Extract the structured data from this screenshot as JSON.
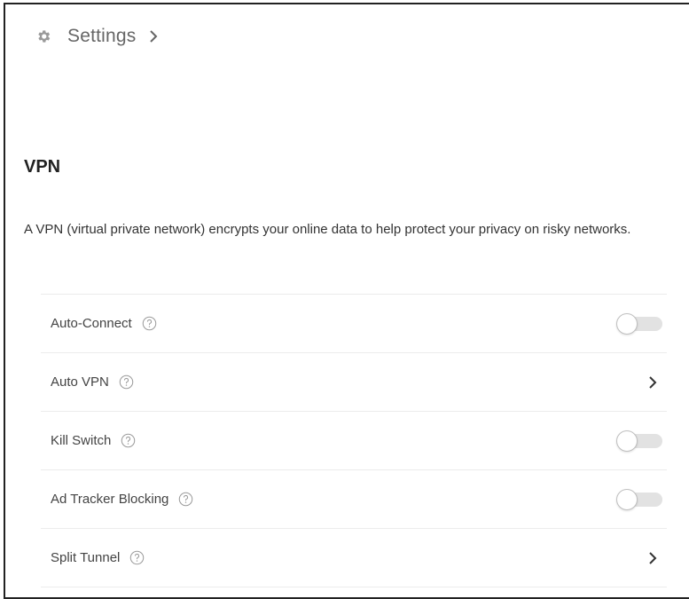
{
  "header": {
    "icon": "gear-icon",
    "title": "Settings",
    "chevron_icon": "chevron-right-icon"
  },
  "section": {
    "title": "VPN",
    "description": "A VPN (virtual private network) encrypts your online data to help protect your privacy on risky networks."
  },
  "settings": [
    {
      "label": "Auto-Connect",
      "help_icon": "help-circle-icon",
      "control": "toggle",
      "on": false
    },
    {
      "label": "Auto VPN",
      "help_icon": "help-circle-icon",
      "control": "chevron",
      "icon": "chevron-right-icon"
    },
    {
      "label": "Kill Switch",
      "help_icon": "help-circle-icon",
      "control": "toggle",
      "on": false
    },
    {
      "label": "Ad Tracker Blocking",
      "help_icon": "help-circle-icon",
      "control": "toggle",
      "on": false
    },
    {
      "label": "Split Tunnel",
      "help_icon": "help-circle-icon",
      "control": "chevron",
      "icon": "chevron-right-icon"
    }
  ],
  "colors": {
    "text": "#333333",
    "muted": "#7a7a7a",
    "divider": "#ececec",
    "toggle_track": "#e2e2e2"
  }
}
